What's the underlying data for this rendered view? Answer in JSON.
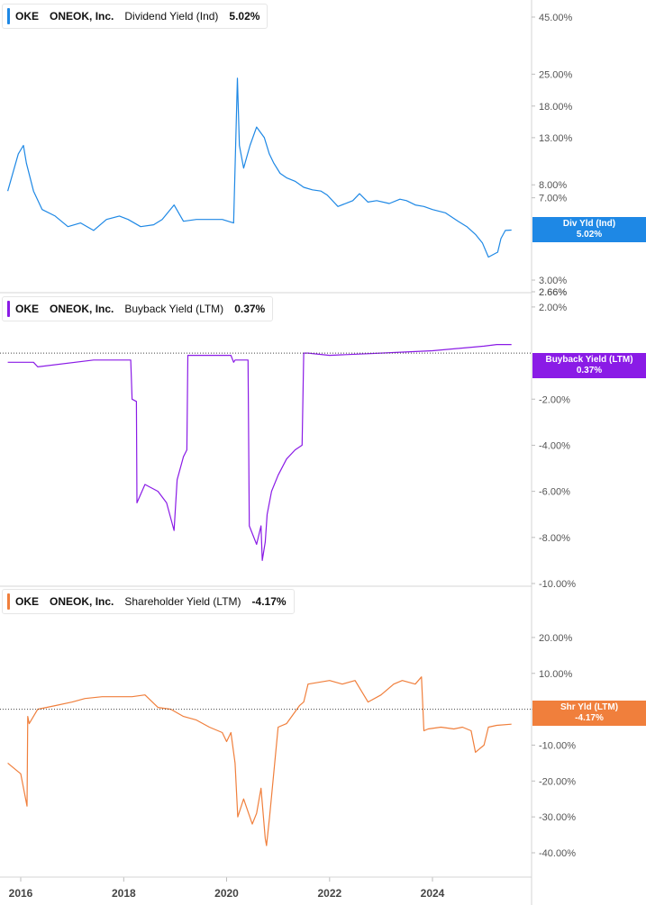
{
  "colors": {
    "div": "#1e88e5",
    "buyback": "#8a1be6",
    "shareholder": "#f07f3c",
    "axis_text": "#555555"
  },
  "chart_data": [
    {
      "type": "line",
      "legend": {
        "ticker": "OKE",
        "name": "ONEOK, Inc.",
        "metric": "Dividend Yield (Ind)",
        "value": "5.02%"
      },
      "flag": {
        "label": "Div Yld (Ind)",
        "value": "5.02%"
      },
      "y_scale": "log",
      "ylim": [
        2.66,
        48
      ],
      "yticks": [
        "45.00%",
        "25.00%",
        "18.00%",
        "13.00%",
        "8.00%",
        "7.00%",
        "3.00%",
        "2.66%"
      ],
      "ytick_values": [
        45,
        25,
        18,
        13,
        8,
        7,
        3,
        2.66
      ],
      "series": [
        {
          "x": [
            "2015-10-01",
            "2015-12-15",
            "2016-01-20",
            "2016-02-10",
            "2016-04-01",
            "2016-06-01",
            "2016-09-01",
            "2016-12-01",
            "2017-03-01",
            "2017-06-01",
            "2017-09-01",
            "2017-12-01",
            "2018-02-01",
            "2018-05-01",
            "2018-08-01",
            "2018-10-01",
            "2018-12-24",
            "2019-03-01",
            "2019-06-01",
            "2019-09-01",
            "2019-12-01",
            "2020-02-20",
            "2020-03-18",
            "2020-04-01",
            "2020-05-01",
            "2020-06-15",
            "2020-08-01",
            "2020-09-25",
            "2020-10-30",
            "2020-12-01",
            "2021-01-15",
            "2021-03-01",
            "2021-05-01",
            "2021-07-01",
            "2021-09-01",
            "2021-11-01",
            "2021-12-15",
            "2022-03-01",
            "2022-06-15",
            "2022-08-01",
            "2022-09-30",
            "2022-12-01",
            "2023-03-01",
            "2023-05-15",
            "2023-07-01",
            "2023-09-01",
            "2023-11-01",
            "2024-01-01",
            "2024-04-01",
            "2024-07-01",
            "2024-09-01",
            "2024-11-01",
            "2024-12-20",
            "2025-02-01",
            "2025-04-08",
            "2025-05-01",
            "2025-06-01",
            "2025-07-15"
          ],
          "values": [
            7.5,
            11,
            12,
            10,
            7.5,
            6.2,
            5.8,
            5.2,
            5.4,
            5.0,
            5.6,
            5.8,
            5.6,
            5.2,
            5.3,
            5.6,
            6.5,
            5.5,
            5.6,
            5.6,
            5.6,
            5.4,
            24,
            12,
            9.5,
            12,
            14.5,
            13,
            11,
            10,
            9,
            8.6,
            8.3,
            7.8,
            7.6,
            7.5,
            7.2,
            6.4,
            6.8,
            7.3,
            6.7,
            6.8,
            6.6,
            6.9,
            6.8,
            6.5,
            6.4,
            6.2,
            6.0,
            5.5,
            5.2,
            4.8,
            4.4,
            3.8,
            4.0,
            4.6,
            5.0,
            5.02
          ]
        }
      ]
    },
    {
      "type": "line",
      "legend": {
        "ticker": "OKE",
        "name": "ONEOK, Inc.",
        "metric": "Buyback Yield (LTM)",
        "value": "0.37%"
      },
      "flag": {
        "label": "Buyback Yield (LTM)",
        "value": "0.37%"
      },
      "ylim": [
        -10,
        2.66
      ],
      "yticks": [
        "2.66%",
        "2.00%",
        "-2.00%",
        "-4.00%",
        "-6.00%",
        "-8.00%",
        "-10.00%"
      ],
      "ytick_values": [
        2.66,
        2,
        -2,
        -4,
        -6,
        -8,
        -10
      ],
      "series": [
        {
          "x": [
            "2015-10-01",
            "2016-04-01",
            "2016-05-01",
            "2017-06-01",
            "2018-01-15",
            "2018-02-20",
            "2018-03-01",
            "2018-04-01",
            "2018-04-05",
            "2018-06-01",
            "2018-09-01",
            "2018-11-01",
            "2018-12-24",
            "2019-01-15",
            "2019-03-01",
            "2019-03-25",
            "2019-04-01",
            "2019-05-01",
            "2019-12-01",
            "2020-02-01",
            "2020-02-20",
            "2020-03-01",
            "2020-04-01",
            "2020-06-01",
            "2020-06-10",
            "2020-08-01",
            "2020-09-01",
            "2020-09-10",
            "2020-10-01",
            "2020-10-15",
            "2020-11-15",
            "2021-01-01",
            "2021-03-01",
            "2021-05-01",
            "2021-06-20",
            "2021-07-01",
            "2021-08-01",
            "2022-01-01",
            "2023-01-01",
            "2024-01-01",
            "2025-01-01",
            "2025-04-01",
            "2025-07-15"
          ],
          "values": [
            -0.4,
            -0.4,
            -0.6,
            -0.3,
            -0.3,
            -0.3,
            -2,
            -2.1,
            -6.5,
            -5.7,
            -6.0,
            -6.5,
            -7.7,
            -5.5,
            -4.5,
            -4.2,
            -0.1,
            -0.1,
            -0.1,
            -0.1,
            -0.4,
            -0.3,
            -0.3,
            -0.3,
            -7.5,
            -8.3,
            -7.5,
            -9.0,
            -8.2,
            -7.0,
            -6.0,
            -5.3,
            -4.6,
            -4.2,
            -4.0,
            0,
            0,
            -0.1,
            0,
            0.1,
            0.3,
            0.37,
            0.37
          ]
        }
      ]
    },
    {
      "type": "line",
      "legend": {
        "ticker": "OKE",
        "name": "ONEOK, Inc.",
        "metric": "Shareholder Yield (LTM)",
        "value": "-4.17%"
      },
      "flag": {
        "label": "Shr Yld (LTM)",
        "value": "-4.17%"
      },
      "ylim": [
        -41,
        26
      ],
      "yticks": [
        "20.00%",
        "10.00%",
        "0.00%",
        "-10.00%",
        "-20.00%",
        "-30.00%",
        "-40.00%"
      ],
      "ytick_values": [
        20,
        10,
        0,
        -10,
        -20,
        -30,
        -40
      ],
      "series": [
        {
          "x": [
            "2015-10-01",
            "2016-01-01",
            "2016-02-15",
            "2016-02-20",
            "2016-03-01",
            "2016-05-01",
            "2016-09-01",
            "2017-01-01",
            "2017-04-01",
            "2017-08-01",
            "2017-12-01",
            "2018-03-01",
            "2018-06-01",
            "2018-09-01",
            "2018-12-01",
            "2019-03-01",
            "2019-06-01",
            "2019-09-01",
            "2019-12-01",
            "2020-01-01",
            "2020-02-01",
            "2020-03-01",
            "2020-03-20",
            "2020-05-01",
            "2020-07-01",
            "2020-08-01",
            "2020-09-01",
            "2020-10-01",
            "2020-10-10",
            "2020-11-01",
            "2021-01-01",
            "2021-03-01",
            "2021-06-01",
            "2021-07-01",
            "2021-08-01",
            "2022-01-01",
            "2022-04-01",
            "2022-07-01",
            "2022-10-01",
            "2023-01-01",
            "2023-04-01",
            "2023-06-01",
            "2023-09-01",
            "2023-10-15",
            "2023-11-01",
            "2023-12-01",
            "2024-03-01",
            "2024-06-01",
            "2024-08-01",
            "2024-10-01",
            "2024-11-01",
            "2024-12-01",
            "2025-01-01",
            "2025-02-01",
            "2025-04-01",
            "2025-07-15"
          ],
          "values": [
            -15,
            -18,
            -27,
            -2,
            -4,
            0,
            1,
            2,
            3,
            3.5,
            3.5,
            3.5,
            4,
            0.5,
            0,
            -2,
            -3,
            -5,
            -6.5,
            -9,
            -6.5,
            -15,
            -30,
            -25,
            -32,
            -29,
            -22,
            -36,
            -38,
            -30,
            -5,
            -4,
            1,
            2,
            7,
            8,
            7,
            8,
            2,
            4,
            7,
            8,
            7,
            9,
            -6,
            -5.5,
            -5,
            -5.5,
            -5,
            -6,
            -12,
            -11,
            -10,
            -5,
            -4.5,
            -4.17
          ]
        }
      ]
    }
  ],
  "x_axis": {
    "ticks": [
      "2016",
      "2018",
      "2020",
      "2022",
      "2024"
    ],
    "tick_dates": [
      "2016-01-01",
      "2018-01-01",
      "2020-01-01",
      "2022-01-01",
      "2024-01-01"
    ]
  }
}
